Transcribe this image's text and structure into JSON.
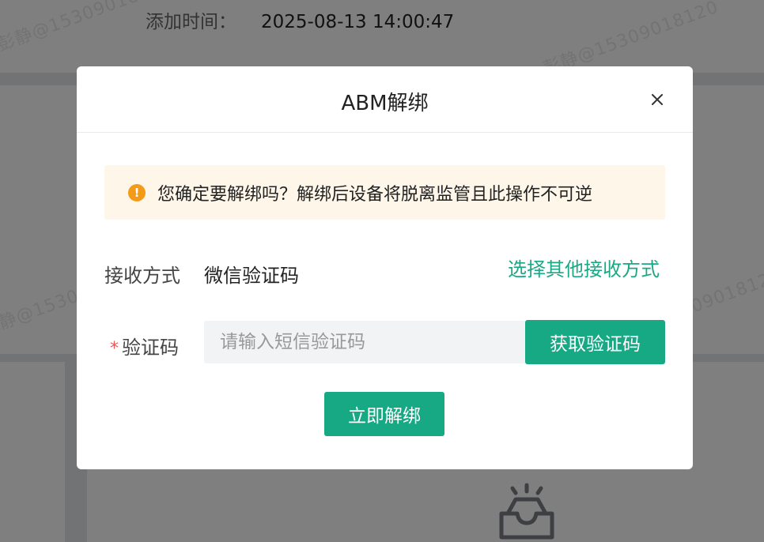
{
  "background": {
    "added_time_label": "添加时间：",
    "added_time_value": "2025-08-13 14:00:47",
    "watermark": "彭静@15309018120"
  },
  "dialog": {
    "title": "ABM解绑",
    "close_icon": "close-icon",
    "alert": {
      "icon": "warning-circle-icon",
      "text": "您确定要解绑吗？解绑后设备将脱离监管且此操作不可逆"
    },
    "receive": {
      "label": "接收方式",
      "value": "微信验证码",
      "switch_link": "选择其他接收方式"
    },
    "code": {
      "required_mark": "*",
      "label": "验证码",
      "placeholder": "请输入短信验证码",
      "value": "",
      "get_code_label": "获取验证码"
    },
    "submit_label": "立即解绑"
  },
  "colors": {
    "primary": "#17a884",
    "warning": "#f39a17",
    "alert_bg": "#fef6e9",
    "mask": "rgba(0,0,0,0.5)"
  }
}
